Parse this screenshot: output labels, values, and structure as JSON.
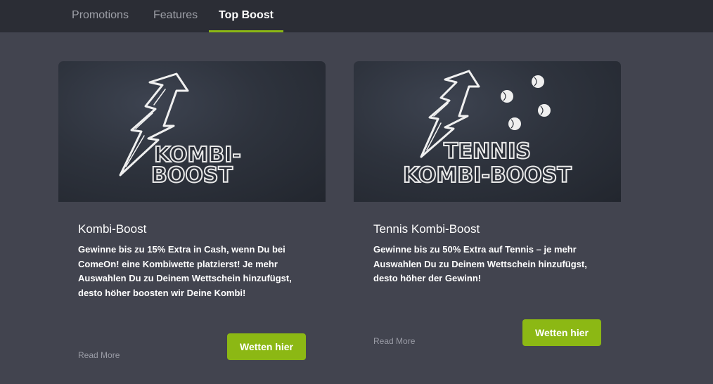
{
  "nav": {
    "tabs": [
      {
        "label": "Promotions"
      },
      {
        "label": "Features"
      },
      {
        "label": "Top Boost"
      }
    ]
  },
  "cards": [
    {
      "image_lines": [
        "KOMBI-",
        "BOOST"
      ],
      "title": "Kombi-Boost",
      "description": "Gewinne bis zu 15% Extra in Cash, wenn Du bei ComeOn! eine Kombiwette platzierst! Je mehr Auswahlen Du zu Deinem Wettschein hinzufügst, desto höher boosten wir Deine Kombi!",
      "read_more": "Read More",
      "button": "Wetten hier"
    },
    {
      "image_lines": [
        "TENNIS",
        "KOMBI-BOOST"
      ],
      "title": "Tennis Kombi-Boost",
      "description": "Gewinne bis zu 50% Extra auf Tennis – je mehr Auswahlen Du zu Deinem Wettschein hinzufügst, desto höher der Gewinn!",
      "read_more": "Read More",
      "button": "Wetten hier"
    }
  ],
  "colors": {
    "accent": "#8cb814",
    "background": "#42444f",
    "nav_background": "#2b2d35"
  }
}
